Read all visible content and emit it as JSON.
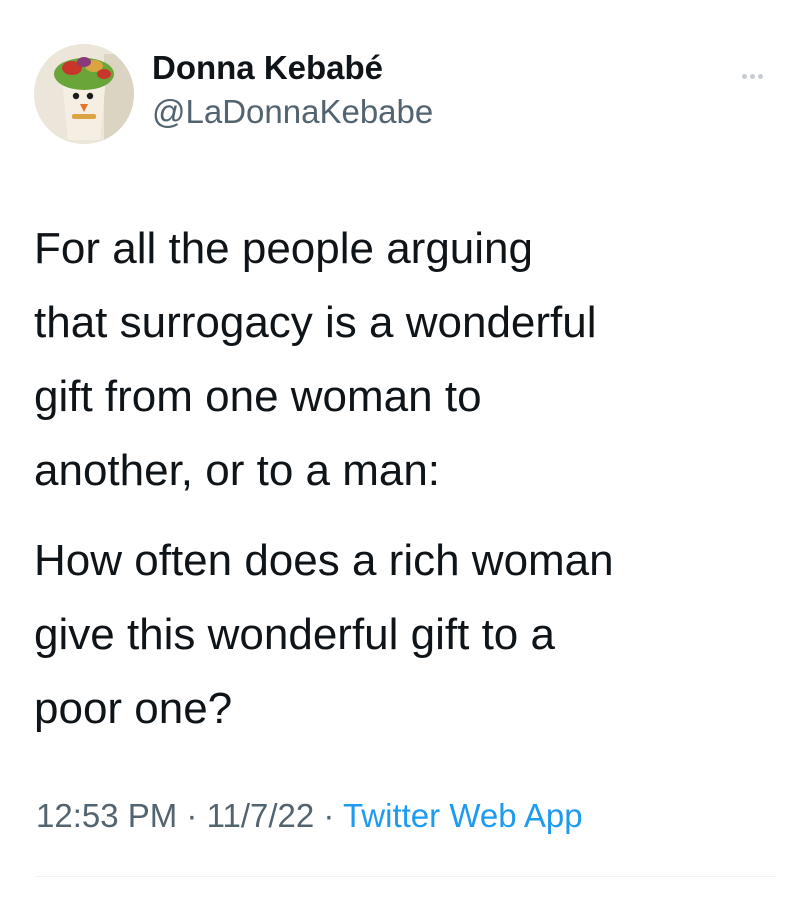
{
  "tweet": {
    "author": {
      "display_name": "Donna Kebabé",
      "handle": "@LaDonnaKebabe",
      "avatar_icon": "avatar-kebab-image"
    },
    "more_icon": "more-dots-icon",
    "paragraphs": [
      "For all the people arguing\nthat surrogacy is a wonderful\ngift from one woman to\nanother, or to a man:",
      "How often does a rich woman\ngive this wonderful gift to a\npoor one?"
    ],
    "meta": {
      "time": "12:53 PM",
      "sep1": " · ",
      "date": "11/7/22",
      "sep2": " · ",
      "source": "Twitter Web App"
    }
  },
  "colors": {
    "text": "#0f1419",
    "secondary": "#536471",
    "link": "#1d9bf0",
    "divider": "#eff3f4"
  }
}
